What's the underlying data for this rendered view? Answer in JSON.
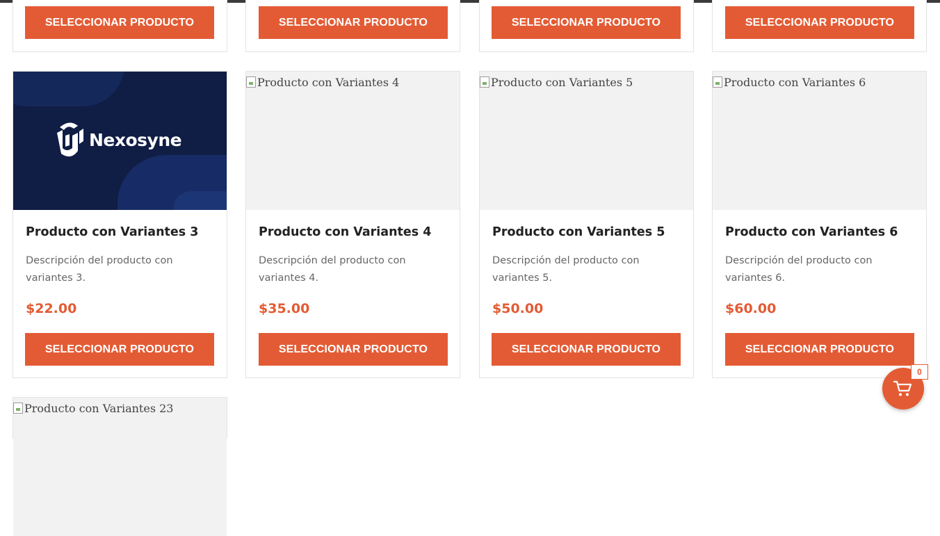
{
  "top_row": {
    "buttons": [
      "SELECCIONAR PRODUCTO",
      "SELECCIONAR PRODUCTO",
      "SELECCIONAR PRODUCTO",
      "SELECCIONAR PRODUCTO"
    ]
  },
  "products": [
    {
      "title": "Producto con Variantes 3",
      "image_brand": "Nexosyne",
      "description": "Descripción del producto con variantes 3.",
      "price": "$22.00",
      "button": "SELECCIONAR PRODUCTO"
    },
    {
      "title": "Producto con Variantes 4",
      "image_alt": "Producto con Variantes 4",
      "description": "Descripción del producto con variantes 4.",
      "price": "$35.00",
      "button": "SELECCIONAR PRODUCTO"
    },
    {
      "title": "Producto con Variantes 5",
      "image_alt": "Producto con Variantes 5",
      "description": "Descripción del producto con variantes 5.",
      "price": "$50.00",
      "button": "SELECCIONAR PRODUCTO"
    },
    {
      "title": "Producto con Variantes 6",
      "image_alt": "Producto con Variantes 6",
      "description": "Descripción del producto con variantes 6.",
      "price": "$60.00",
      "button": "SELECCIONAR PRODUCTO"
    }
  ],
  "bottom_row": {
    "image_alt": "Producto con Variantes 23"
  },
  "cart": {
    "count": "0",
    "icon": "shopping-cart-icon"
  },
  "colors": {
    "accent": "#e35b34",
    "logo_background": "#101d45"
  }
}
